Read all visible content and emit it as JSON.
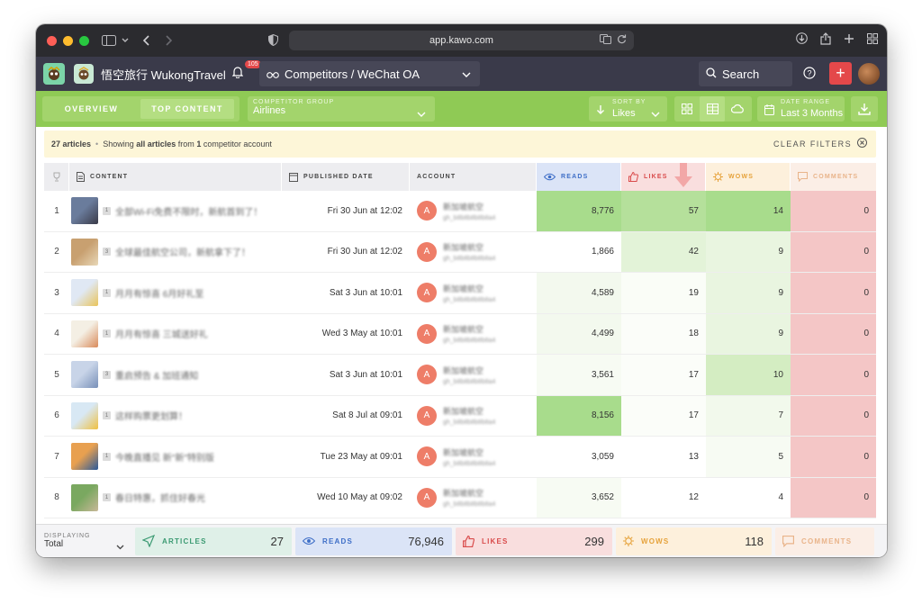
{
  "browser": {
    "url": "app.kawo.com"
  },
  "appbar": {
    "brand": "悟空旅行 WukongTravel",
    "notification_count": "105",
    "section": "Competitors / WeChat OA",
    "search_label": "Search",
    "help": "?",
    "plus": "+"
  },
  "toolbar": {
    "tabs": [
      "OVERVIEW",
      "TOP CONTENT"
    ],
    "active_tab": "TOP CONTENT",
    "group_label": "COMPETITOR GROUP",
    "group_value": "Airlines",
    "sort_label": "SORT BY",
    "sort_value": "Likes",
    "date_label": "DATE RANGE",
    "date_value": "Last 3 Months"
  },
  "info": {
    "count": "27 articles",
    "sep": "•",
    "text_a": "Showing",
    "text_b": "all articles",
    "text_c": "from",
    "text_d": "1",
    "text_e": "competitor account",
    "clear": "CLEAR FILTERS"
  },
  "table": {
    "headers": {
      "content": "CONTENT",
      "date": "PUBLISHED DATE",
      "account": "ACCOUNT",
      "reads": "READS",
      "likes": "LIKES",
      "wows": "WOWS",
      "comments": "COMMENTS"
    },
    "rows": [
      {
        "rank": "1",
        "tag": "1",
        "title": "全部Wi-Fi免费不限时，新航首到了！",
        "date": "Fri 30 Jun at 12:02",
        "account_initial": "A",
        "account_name": "新加坡航空",
        "account_id": "gh_b8b8b8b8b8a4",
        "reads": "8,776",
        "likes": "57",
        "wows": "14",
        "comments": "0"
      },
      {
        "rank": "2",
        "tag": "3",
        "title": "全球最佳航空公司，新航拿下了！",
        "date": "Fri 30 Jun at 12:02",
        "account_initial": "A",
        "account_name": "新加坡航空",
        "account_id": "gh_b8b8b8b8b8a4",
        "reads": "1,866",
        "likes": "42",
        "wows": "9",
        "comments": "0"
      },
      {
        "rank": "3",
        "tag": "1",
        "title": "月月有惊喜 6月好礼至",
        "date": "Sat 3 Jun at 10:01",
        "account_initial": "A",
        "account_name": "新加坡航空",
        "account_id": "gh_b8b8b8b8b8a4",
        "reads": "4,589",
        "likes": "19",
        "wows": "9",
        "comments": "0"
      },
      {
        "rank": "4",
        "tag": "1",
        "title": "月月有惊喜 三城送好礼",
        "date": "Wed 3 May at 10:01",
        "account_initial": "A",
        "account_name": "新加坡航空",
        "account_id": "gh_b8b8b8b8b8a4",
        "reads": "4,499",
        "likes": "18",
        "wows": "9",
        "comments": "0"
      },
      {
        "rank": "5",
        "tag": "3",
        "title": "重启预告 & 加班通知",
        "date": "Sat 3 Jun at 10:01",
        "account_initial": "A",
        "account_name": "新加坡航空",
        "account_id": "gh_b8b8b8b8b8a4",
        "reads": "3,561",
        "likes": "17",
        "wows": "10",
        "comments": "0"
      },
      {
        "rank": "6",
        "tag": "1",
        "title": "这样购票更划算！",
        "date": "Sat 8 Jul at 09:01",
        "account_initial": "A",
        "account_name": "新加坡航空",
        "account_id": "gh_b8b8b8b8b8a4",
        "reads": "8,156",
        "likes": "17",
        "wows": "7",
        "comments": "0"
      },
      {
        "rank": "7",
        "tag": "1",
        "title": "今晚直播见 新\"新\"特别版",
        "date": "Tue 23 May at 09:01",
        "account_initial": "A",
        "account_name": "新加坡航空",
        "account_id": "gh_b8b8b8b8b8a4",
        "reads": "3,059",
        "likes": "13",
        "wows": "5",
        "comments": "0"
      },
      {
        "rank": "8",
        "tag": "1",
        "title": "春日特惠，抓住好春光",
        "date": "Wed 10 May at 09:02",
        "account_initial": "A",
        "account_name": "新加坡航空",
        "account_id": "gh_b8b8b8b8b8a4",
        "reads": "3,652",
        "likes": "12",
        "wows": "4",
        "comments": "0"
      }
    ]
  },
  "totals": {
    "displaying_label": "DISPLAYING",
    "displaying_value": "Total",
    "articles_label": "ARTICLES",
    "articles": "27",
    "reads_label": "READS",
    "reads": "76,946",
    "likes_label": "LIKES",
    "likes": "299",
    "wows_label": "WOWS",
    "wows": "118",
    "comments_label": "COMMENTS"
  },
  "colors": {
    "green_bar": "#8fca55",
    "reads_head": "#dbe4f7",
    "likes_head": "#f9dede",
    "wows_head": "#fdf0dc",
    "comments_head": "#fbeee6",
    "heat_green_strong": "#a8dc8c",
    "heat_green_light": "#e3f3d8",
    "heat_red": "#f2c2c2",
    "accent_red": "#e4484a"
  }
}
